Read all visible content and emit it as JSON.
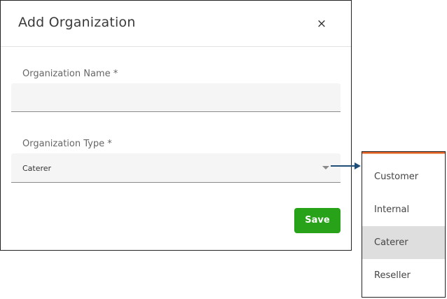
{
  "modal": {
    "title": "Add Organization",
    "close_label": "×",
    "name_field": {
      "label": "Organization Name *",
      "value": "",
      "placeholder": ""
    },
    "type_field": {
      "label": "Organization Type *",
      "selected": "Caterer"
    },
    "save_label": "Save"
  },
  "dropdown": {
    "options": [
      {
        "label": "Customer",
        "selected": false
      },
      {
        "label": "Internal",
        "selected": false
      },
      {
        "label": "Caterer",
        "selected": true
      },
      {
        "label": "Reseller",
        "selected": false
      }
    ]
  },
  "colors": {
    "save_button": "#27a219",
    "arrow": "#1f4e79",
    "dropdown_accent": "#e25a1c",
    "selected_option_bg": "#dedede",
    "field_bg": "#f5f5f5"
  },
  "icons": {
    "close": "close-icon",
    "caret": "caret-down-icon",
    "arrow": "arrow-right-icon"
  }
}
